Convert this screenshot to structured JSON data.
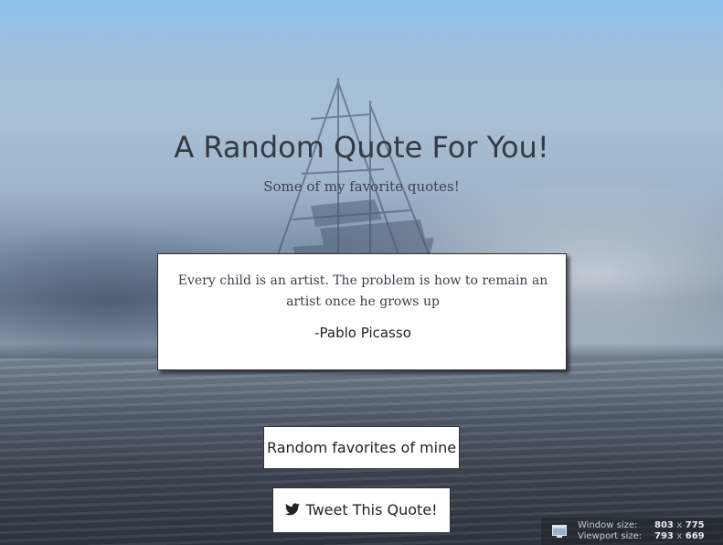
{
  "header": {
    "title": "A Random Quote For You!",
    "subtitle": "Some of my favorite quotes!"
  },
  "quote": {
    "text": "Every child is an artist. The problem is how to remain an artist once he grows up",
    "author": "-Pablo Picasso"
  },
  "buttons": {
    "random_label": "Random favorites of mine",
    "tweet_label": "Tweet This Quote!",
    "tweet_icon": "twitter-bird-icon"
  },
  "size_overlay": {
    "window_label": "Window size:",
    "window_w": "803",
    "window_h": "775",
    "viewport_label": "Viewport size:",
    "viewport_w": "793",
    "viewport_h": "669",
    "separator": "x"
  },
  "colors": {
    "text_dark": "#333a44",
    "card_bg": "#ffffff",
    "border": "#333333"
  }
}
